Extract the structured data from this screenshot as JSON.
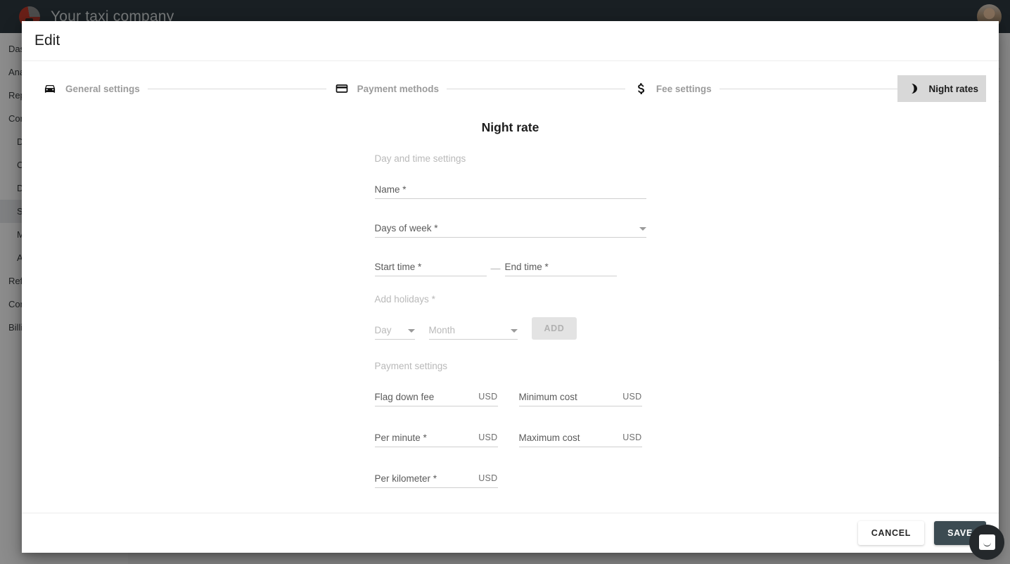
{
  "background": {
    "app_title": "Your taxi company",
    "logo_icon": "taxi-logo-icon",
    "avatar_icon": "user-avatar",
    "sidebar": [
      {
        "label": "Dashboard",
        "sub": false,
        "active": false
      },
      {
        "label": "Analytics",
        "sub": false,
        "active": false
      },
      {
        "label": "Reports",
        "sub": false,
        "active": false
      },
      {
        "label": "Company",
        "sub": false,
        "active": false
      },
      {
        "label": "Drivers",
        "sub": true,
        "active": false
      },
      {
        "label": "Cars",
        "sub": true,
        "active": false
      },
      {
        "label": "Dispatchers",
        "sub": true,
        "active": false
      },
      {
        "label": "Services",
        "sub": true,
        "active": true
      },
      {
        "label": "Messages",
        "sub": true,
        "active": false
      },
      {
        "label": "Areas",
        "sub": true,
        "active": false
      },
      {
        "label": "References",
        "sub": false,
        "active": false
      },
      {
        "label": "Configuration",
        "sub": false,
        "active": false
      },
      {
        "label": "Billing",
        "sub": false,
        "active": false
      }
    ]
  },
  "dialog": {
    "title": "Edit",
    "stepper": [
      {
        "label": "General settings",
        "icon": "car-icon",
        "active": false
      },
      {
        "label": "Payment methods",
        "icon": "credit-card-icon",
        "active": false
      },
      {
        "label": "Fee settings",
        "icon": "dollar-icon",
        "active": false
      },
      {
        "label": "Night rates",
        "icon": "moon-icon",
        "active": true
      }
    ],
    "form": {
      "heading": "Night rate",
      "section_day_time": "Day and time settings",
      "section_payment": "Payment settings",
      "name": {
        "label": "Name",
        "required": true,
        "value": ""
      },
      "days_of_week": {
        "label": "Days of week",
        "required": true,
        "value": ""
      },
      "start_time": {
        "label": "Start time",
        "required": true,
        "value": ""
      },
      "end_time": {
        "label": "End time",
        "required": true,
        "value": ""
      },
      "range_separator": "—",
      "add_holidays": {
        "label": "Add holidays",
        "required": true
      },
      "holiday_day": {
        "label": "Day",
        "value": ""
      },
      "holiday_month": {
        "label": "Month",
        "value": ""
      },
      "add_button": "ADD",
      "currency": "USD",
      "flag_down_fee": {
        "label": "Flag down fee",
        "required": false,
        "value": ""
      },
      "minimum_cost": {
        "label": "Minimum cost",
        "required": false,
        "value": ""
      },
      "per_minute": {
        "label": "Per minute",
        "required": true,
        "value": ""
      },
      "maximum_cost": {
        "label": "Maximum cost",
        "required": false,
        "value": ""
      },
      "per_kilometer": {
        "label": "Per kilometer",
        "required": true,
        "value": ""
      }
    },
    "footer": {
      "cancel": "CANCEL",
      "save": "SAVE"
    }
  },
  "chat": {
    "icon": "chat-bubble-icon"
  },
  "colors": {
    "topbar": "#2f3a40",
    "save_button": "#3c4b52",
    "active_step": "#d8d8d8",
    "muted_text": "#b9b9b9"
  }
}
